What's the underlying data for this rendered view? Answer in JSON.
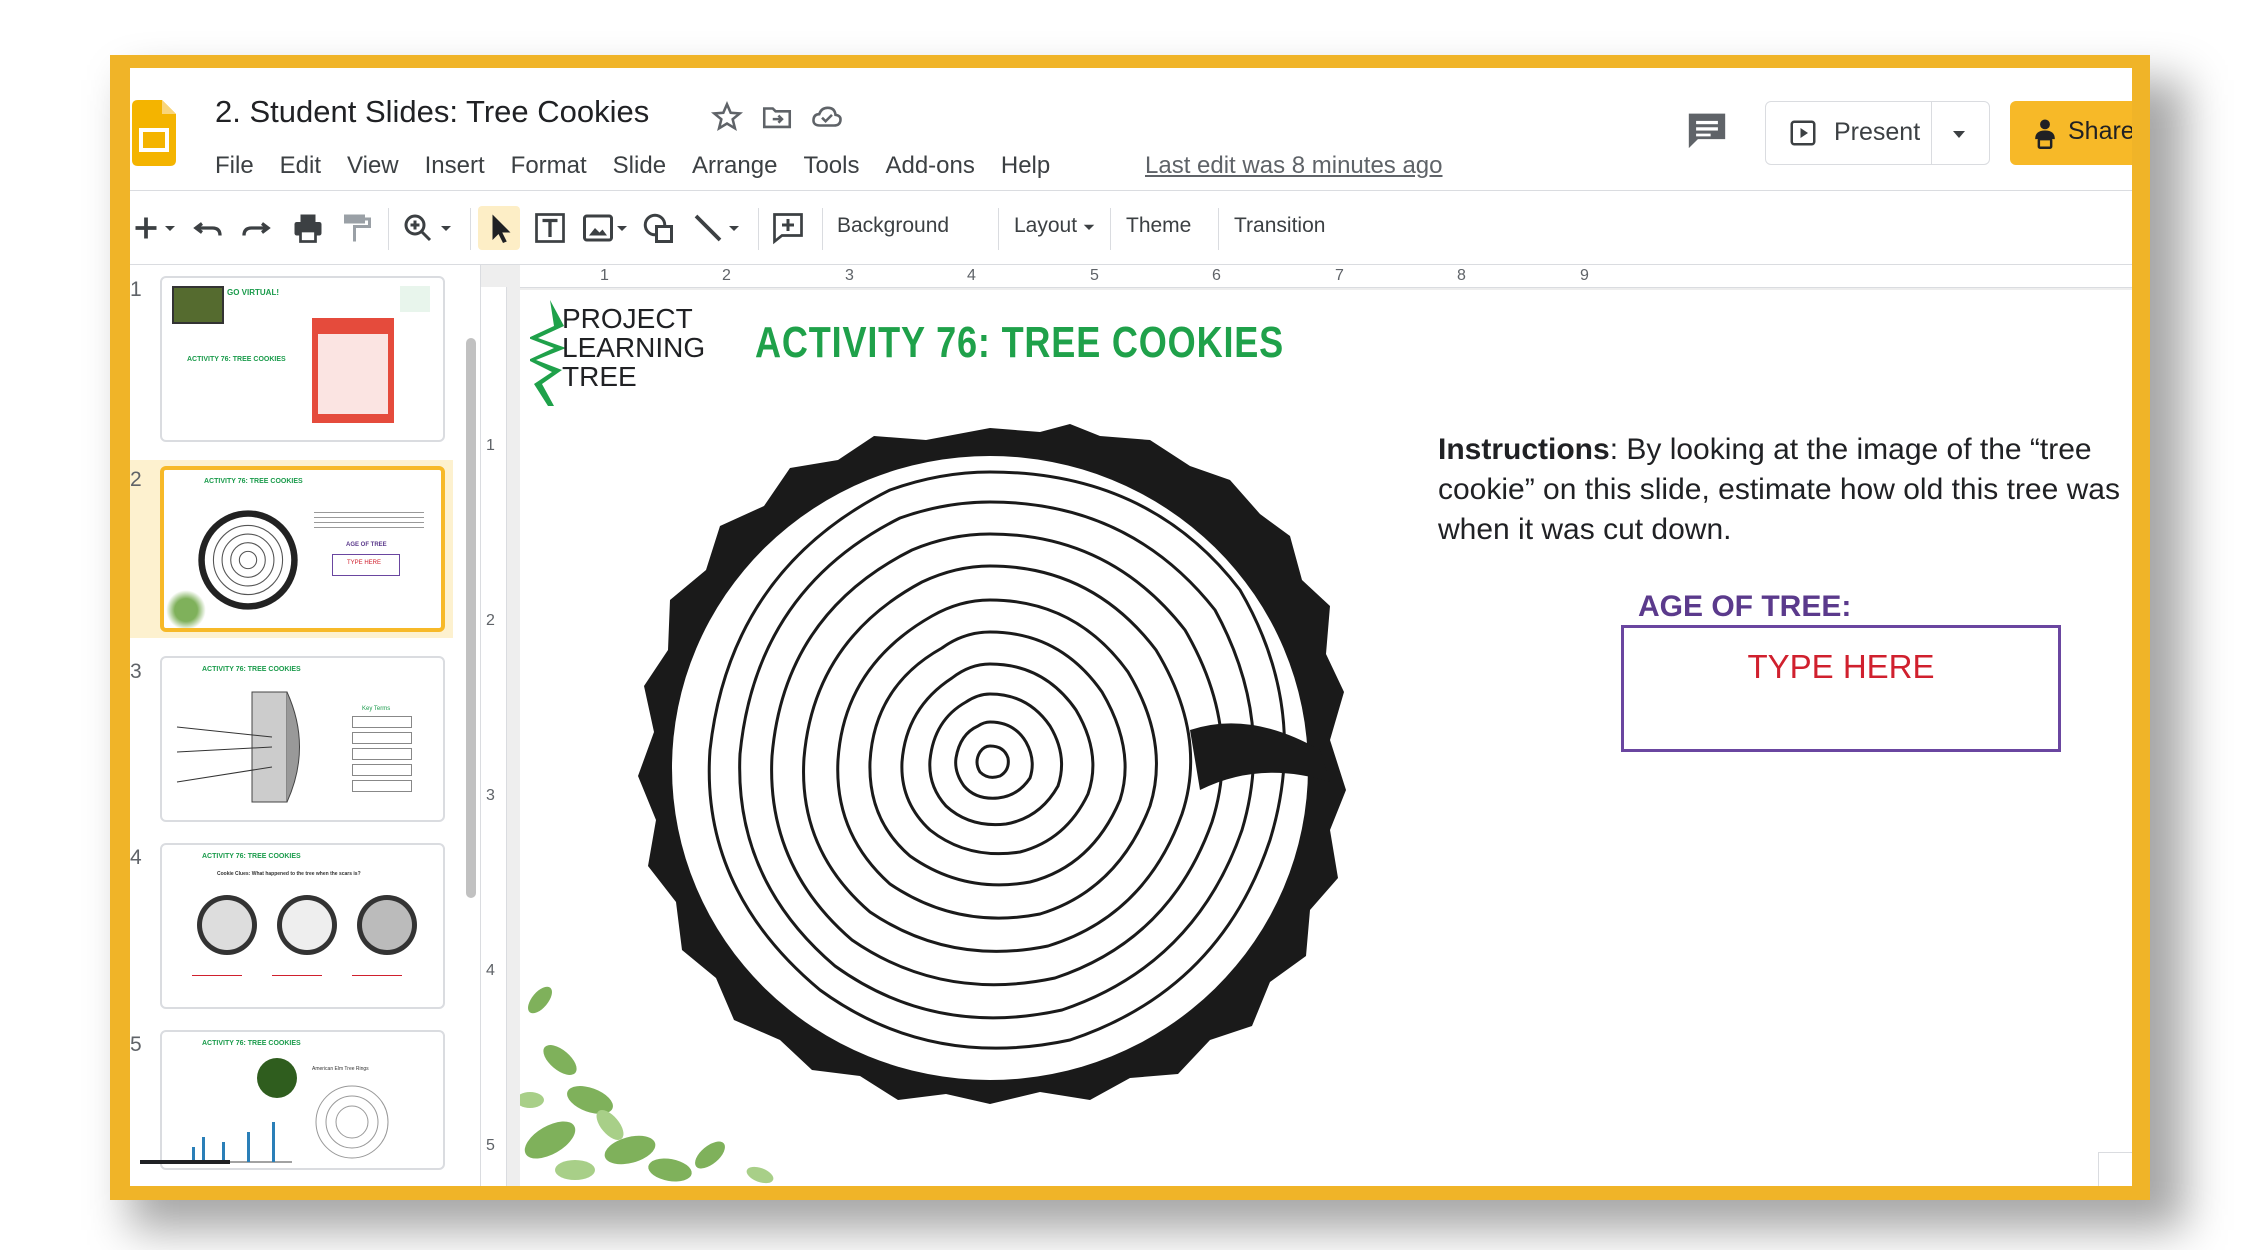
{
  "app": {
    "doc_title": "2. Student Slides: Tree Cookies",
    "last_edit": "Last edit was 8 minutes ago"
  },
  "menu": [
    "File",
    "Edit",
    "View",
    "Insert",
    "Format",
    "Slide",
    "Arrange",
    "Tools",
    "Add-ons",
    "Help"
  ],
  "header": {
    "present_label": "Present",
    "share_label": "Share"
  },
  "toolbar": {
    "background_label": "Background",
    "layout_label": "Layout",
    "theme_label": "Theme",
    "transition_label": "Transition"
  },
  "ruler": {
    "h_ticks": [
      "1",
      "2",
      "3",
      "4",
      "5",
      "6",
      "7",
      "8",
      "9"
    ],
    "v_ticks": [
      "1",
      "2",
      "3",
      "4",
      "5"
    ]
  },
  "filmstrip": {
    "slides": [
      {
        "num": "1",
        "label": "ACTIVITY 76: TREE COOKIES",
        "heading": "GO VIRTUAL!"
      },
      {
        "num": "2",
        "label": "ACTIVITY 76: TREE COOKIES",
        "box": "TYPE HERE",
        "age": "AGE OF TREE"
      },
      {
        "num": "3",
        "label": "ACTIVITY 76: TREE COOKIES",
        "keyterms": "Key Terms"
      },
      {
        "num": "4",
        "label": "ACTIVITY 76: TREE COOKIES",
        "prompt": "Cookie Clues: What happened to the tree when the scars is?"
      },
      {
        "num": "5",
        "label": "ACTIVITY 76: TREE COOKIES",
        "ring_label": "American Elm Tree Rings"
      }
    ],
    "selected_index": 2
  },
  "slide": {
    "logo_lines": [
      "PROJECT",
      "LEARNING",
      "TREE"
    ],
    "title": "ACTIVITY 76: TREE COOKIES",
    "instructions_bold": "Instructions",
    "instructions_rest": ": By looking at the image of the “tree cookie” on this slide, estimate how old this tree was when it was cut down.",
    "age_label": "AGE OF TREE:",
    "answer_placeholder": "TYPE HERE"
  },
  "colors": {
    "accent": "#f7b928",
    "frame": "#f0b428",
    "title_green": "#1fa14a",
    "age_purple": "#5b3a8c",
    "placeholder_red": "#d0202e"
  }
}
